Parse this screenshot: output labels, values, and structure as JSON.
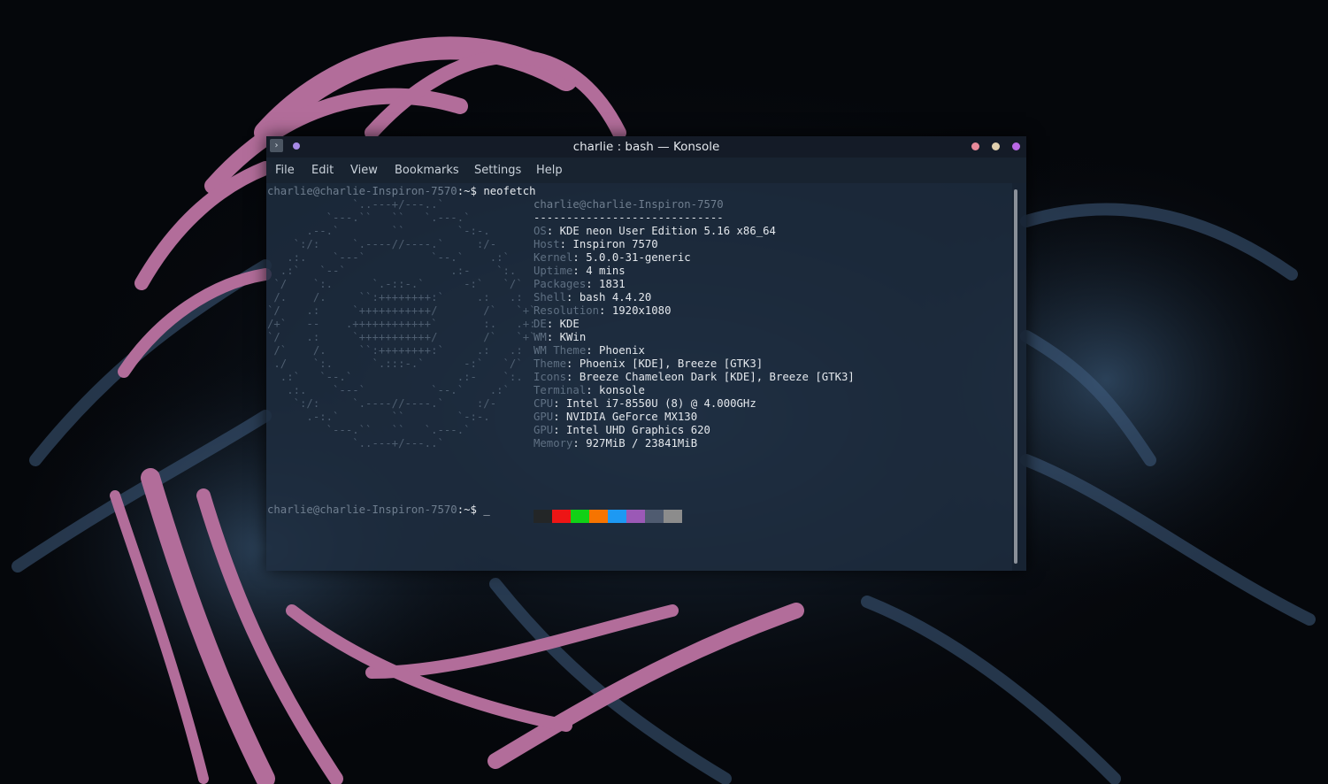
{
  "window": {
    "title": "charlie : bash — Konsole"
  },
  "menubar": {
    "items": [
      "File",
      "Edit",
      "View",
      "Bookmarks",
      "Settings",
      "Help"
    ]
  },
  "terminal": {
    "prompt": "charlie@charlie-Inspiron-7570",
    "prompt_suffix": ":~$",
    "command": "neofetch",
    "cursor": "_",
    "ascii_art": [
      "             `..---+/---..`",
      "         `---.``   ``   `.---.`",
      "      .--.`        ``        `-:-.",
      "    `:/:     `.----//----.`     :/-",
      "   .:.    `---`          `--.`    .:`",
      "  .:`   `--`                .:-    `:.",
      " `/    `:.      `.-::-.`      -:`   `/`",
      " /.    /.     ``:++++++++:`     .:   .:",
      "`/    .:     `+++++++++++/       /`   `+`",
      "/+`   --    .++++++++++++`       :.   .+:",
      "`/    .:     `+++++++++++/       /`   `+`",
      " /`    /.     ``:++++++++:`     .:   .:",
      " ./    `:.      `.:::-.`      -:`   `/`",
      "  .:`   `--.`                .:-    `:.",
      "   .:.    `---`          `--.`    .:`",
      "    `:/:     `.----//----.`     :/-",
      "      .-:.`        ``        `-:-.",
      "         `---.``   ``   `.---.`",
      "             `..---+/---..`"
    ],
    "header": "charlie@charlie-Inspiron-7570",
    "separator": "-----------------------------",
    "info": [
      {
        "label": "OS",
        "value": "KDE neon User Edition 5.16 x86_64"
      },
      {
        "label": "Host",
        "value": "Inspiron 7570"
      },
      {
        "label": "Kernel",
        "value": "5.0.0-31-generic"
      },
      {
        "label": "Uptime",
        "value": "4 mins"
      },
      {
        "label": "Packages",
        "value": "1831"
      },
      {
        "label": "Shell",
        "value": "bash 4.4.20"
      },
      {
        "label": "Resolution",
        "value": "1920x1080"
      },
      {
        "label": "DE",
        "value": "KDE"
      },
      {
        "label": "WM",
        "value": "KWin"
      },
      {
        "label": "WM Theme",
        "value": "Phoenix"
      },
      {
        "label": "Theme",
        "value": "Phoenix [KDE], Breeze [GTK3]"
      },
      {
        "label": "Icons",
        "value": "Breeze Chameleon Dark [KDE], Breeze [GTK3]"
      },
      {
        "label": "Terminal",
        "value": "konsole"
      },
      {
        "label": "CPU",
        "value": "Intel i7-8550U (8) @ 4.000GHz"
      },
      {
        "label": "GPU",
        "value": "NVIDIA GeForce MX130"
      },
      {
        "label": "GPU",
        "value": "Intel UHD Graphics 620"
      },
      {
        "label": "Memory",
        "value": "927MiB / 23841MiB"
      }
    ],
    "palette": [
      "#232627",
      "#ed1515",
      "#11d116",
      "#f67400",
      "#1d99f3",
      "#9b59b6",
      "#4f5b70",
      "#8c8c8c"
    ]
  },
  "colors": {
    "wallpaper_pink": "#b26d9a",
    "wallpaper_blue": "#3c5a7a",
    "terminal_bg": "#1e2d40"
  }
}
